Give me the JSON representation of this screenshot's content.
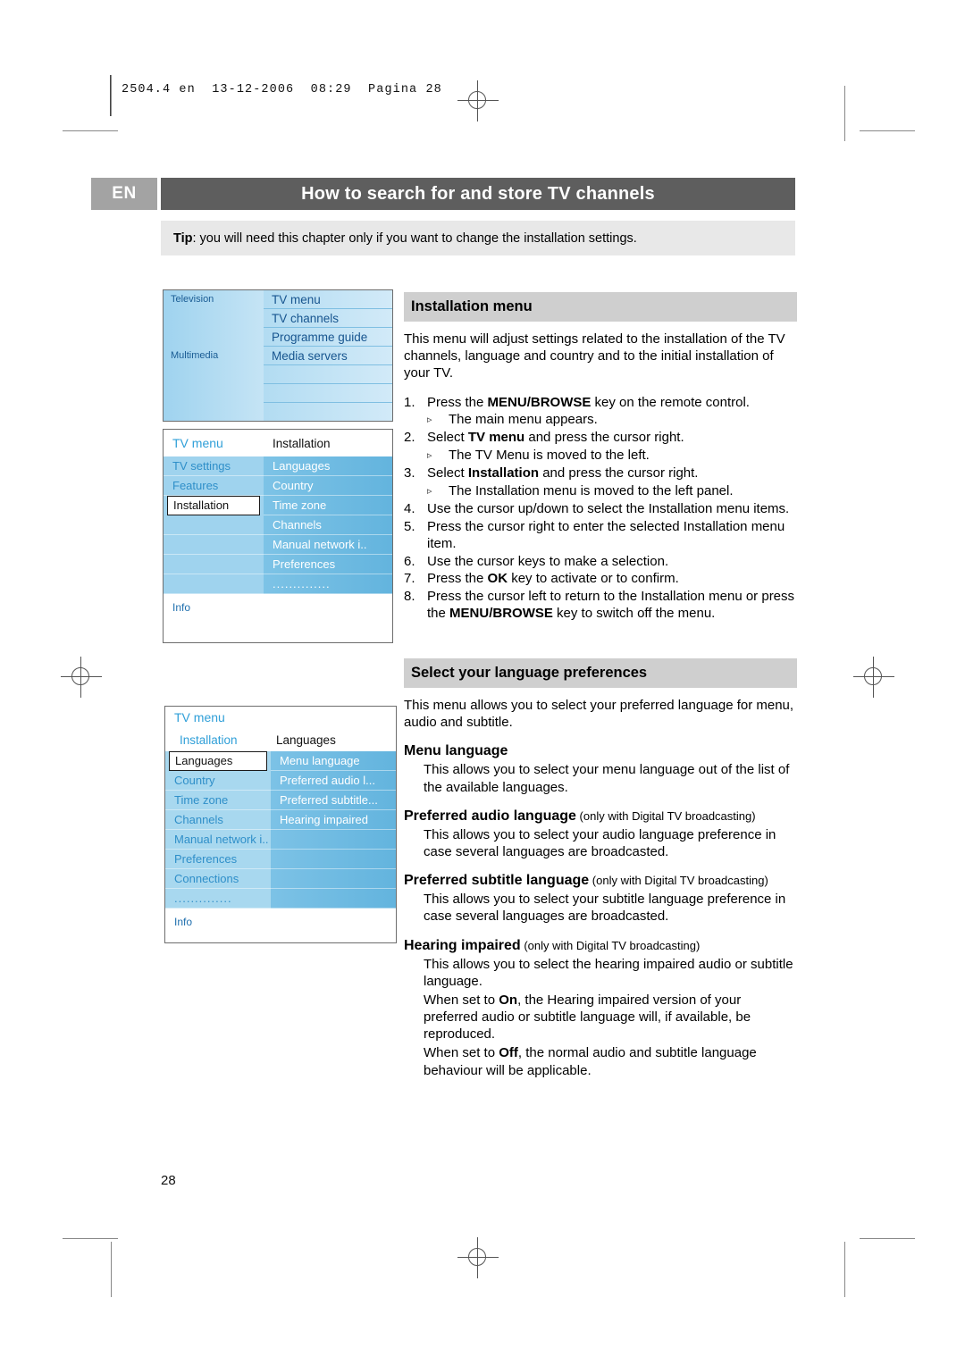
{
  "slug": {
    "text": "2504.4 en  13-12-2006  08:29  Pagina 28"
  },
  "header": {
    "lang_badge": "EN",
    "chapter_title": "How to search for and store TV channels"
  },
  "tip": {
    "label": "Tip",
    "text": ": you will need this chapter only if you want to change the installation settings."
  },
  "mock_main_menu": {
    "left_items": [
      "Television",
      "Multimedia"
    ],
    "right_items": [
      "TV menu",
      "TV channels",
      "Programme guide",
      "Media servers"
    ]
  },
  "mock_installation": {
    "breadcrumb_left": "TV menu",
    "breadcrumb_right": "Installation",
    "left_items": [
      "TV settings",
      "Features",
      "Installation"
    ],
    "selected_left": "Installation",
    "right_items": [
      "Languages",
      "Country",
      "Time zone",
      "Channels",
      "Manual network i..",
      "Preferences"
    ],
    "right_dots": "..............",
    "info_label": "Info"
  },
  "mock_languages": {
    "title": "TV menu",
    "breadcrumb_left": "Installation",
    "breadcrumb_right": "Languages",
    "left_items": [
      "Languages",
      "Country",
      "Time zone",
      "Channels",
      "Manual network i..",
      "Preferences",
      "Connections"
    ],
    "selected_left": "Languages",
    "left_dots": "..............",
    "right_items": [
      "Menu language",
      "Preferred audio l...",
      "Preferred subtitle...",
      "Hearing impaired"
    ],
    "info_label": "Info"
  },
  "installation_section": {
    "heading": "Installation menu",
    "intro": "This menu will adjust settings related to the installation of the TV channels, language and country and to the initial installation of your TV.",
    "steps": [
      {
        "num": "1.",
        "pre": "Press the ",
        "bold": "MENU/BROWSE",
        "post": " key on the remote control."
      },
      {
        "num": "2.",
        "pre": "Select ",
        "bold": "TV menu",
        "post": " and press the cursor right."
      },
      {
        "num": "3.",
        "pre": "Select ",
        "bold": "Installation",
        "post": " and press the cursor right."
      },
      {
        "num": "4.",
        "pre": "Use the cursor up/down to select the Installation menu items.",
        "bold": "",
        "post": ""
      },
      {
        "num": "5.",
        "pre": "Press the cursor right to enter the selected Installation menu item.",
        "bold": "",
        "post": ""
      },
      {
        "num": "6.",
        "pre": "Use the cursor keys to make a selection.",
        "bold": "",
        "post": ""
      },
      {
        "num": "7.",
        "pre": "Press the ",
        "bold": "OK",
        "post": " key to activate or to confirm."
      },
      {
        "num": "8.",
        "pre": "Press the cursor left to return to the Installation menu or press the ",
        "bold": "MENU/BROWSE",
        "post": " key to switch off the menu."
      }
    ],
    "sub_1": "The main menu appears.",
    "sub_2": "The TV Menu is moved to the left.",
    "sub_3": "The Installation menu is moved to the left panel.",
    "bullet_glyph": "▹"
  },
  "language_section": {
    "heading": "Select your language preferences",
    "intro": "This menu allows you to select your preferred language for menu, audio and subtitle.",
    "items": [
      {
        "title": "Menu language",
        "note": "",
        "body": "This allows you to select your menu language out of the list of the available languages."
      },
      {
        "title": "Preferred audio language",
        "note": " (only with Digital TV broadcasting)",
        "body": "This allows you to select your audio language preference in case several languages are broadcasted."
      },
      {
        "title": "Preferred subtitle language",
        "note": " (only with Digital TV broadcasting)",
        "body": "This allows you to select your subtitle language preference in case several languages are broadcasted."
      },
      {
        "title": "Hearing impaired",
        "note": " (only with Digital TV broadcasting)",
        "body": "This allows you to select the hearing impaired audio or subtitle language."
      }
    ],
    "on_line_pre": "When set to ",
    "on_bold": "On",
    "on_line_post": ", the Hearing impaired version of your preferred audio or subtitle language will, if available, be reproduced.",
    "off_line_pre": "When set to ",
    "off_bold": "Off",
    "off_line_post": ", the normal audio and subtitle language behaviour will be applicable."
  },
  "footer": {
    "page_number": "28"
  }
}
